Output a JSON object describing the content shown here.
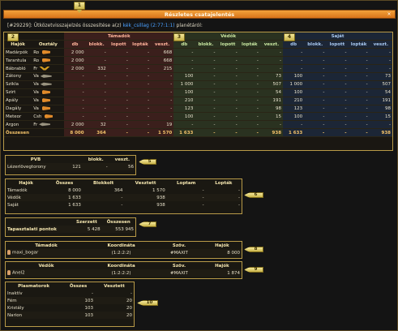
{
  "window": {
    "title": "Részletes csatajelentés",
    "close_symbol": "×"
  },
  "intro": {
    "prefix": "[#29229]: Ütközetvisszajelzés összesítése a(z) ",
    "link": "kék_csillag (2:77:1:1)",
    "suffix": " planétáról:"
  },
  "markers": [
    "1",
    "2",
    "3",
    "4",
    "5",
    "6",
    "7",
    "8",
    "9",
    "10"
  ],
  "battle": {
    "group_headers": {
      "attackers": "Támadók",
      "defenders": "Védők",
      "own": "Saját"
    },
    "col_ships": "Hajók",
    "col_class": "Osztály",
    "sub_cols": [
      "db",
      "blokk.",
      "lopott",
      "lopták",
      "veszt."
    ],
    "rows": [
      {
        "name": "Madárpók",
        "class": "Ro",
        "icon": "orange",
        "a": [
          "2 000",
          "-",
          "-",
          "-",
          "668"
        ],
        "d": [
          "-",
          "-",
          "-",
          "-",
          "-"
        ],
        "s": [
          "-",
          "-",
          "-",
          "-",
          "-"
        ]
      },
      {
        "name": "Tarantula",
        "class": "Ro",
        "icon": "orange",
        "a": [
          "2 000",
          "-",
          "-",
          "-",
          "668"
        ],
        "d": [
          "-",
          "-",
          "-",
          "-",
          "-"
        ],
        "s": [
          "-",
          "-",
          "-",
          "-",
          "-"
        ]
      },
      {
        "name": "Bábrabló",
        "class": "Fr",
        "icon": "ywing",
        "a": [
          "2 000",
          "332",
          "-",
          "-",
          "215"
        ],
        "d": [
          "-",
          "-",
          "-",
          "-",
          "-"
        ],
        "s": [
          "-",
          "-",
          "-",
          "-",
          "-"
        ]
      },
      {
        "name": "Zátony",
        "class": "Va",
        "icon": "grey",
        "a": [
          "-",
          "-",
          "-",
          "-",
          "-"
        ],
        "d": [
          "100",
          "-",
          "-",
          "-",
          "73"
        ],
        "s": [
          "100",
          "-",
          "-",
          "-",
          "73"
        ]
      },
      {
        "name": "Szikla",
        "class": "Va",
        "icon": "grey",
        "a": [
          "-",
          "-",
          "-",
          "-",
          "-"
        ],
        "d": [
          "1 000",
          "-",
          "-",
          "-",
          "507"
        ],
        "s": [
          "1 000",
          "-",
          "-",
          "-",
          "507"
        ]
      },
      {
        "name": "Szirt",
        "class": "Va",
        "icon": "orange",
        "a": [
          "-",
          "-",
          "-",
          "-",
          "-"
        ],
        "d": [
          "100",
          "-",
          "-",
          "-",
          "54"
        ],
        "s": [
          "100",
          "-",
          "-",
          "-",
          "54"
        ]
      },
      {
        "name": "Apály",
        "class": "Va",
        "icon": "orange",
        "a": [
          "-",
          "-",
          "-",
          "-",
          "-"
        ],
        "d": [
          "210",
          "-",
          "-",
          "-",
          "191"
        ],
        "s": [
          "210",
          "-",
          "-",
          "-",
          "191"
        ]
      },
      {
        "name": "Dagály",
        "class": "Va",
        "icon": "orange",
        "a": [
          "-",
          "-",
          "-",
          "-",
          "-"
        ],
        "d": [
          "123",
          "-",
          "-",
          "-",
          "98"
        ],
        "s": [
          "123",
          "-",
          "-",
          "-",
          "98"
        ]
      },
      {
        "name": "Meteor",
        "class": "Csh",
        "icon": "orange",
        "a": [
          "-",
          "-",
          "-",
          "-",
          "-"
        ],
        "d": [
          "100",
          "-",
          "-",
          "-",
          "15"
        ],
        "s": [
          "100",
          "-",
          "-",
          "-",
          "15"
        ]
      },
      {
        "name": "Argon",
        "class": "Fr",
        "icon": "grey",
        "a": [
          "2 000",
          "32",
          "-",
          "-",
          "19"
        ],
        "d": [
          "-",
          "-",
          "-",
          "-",
          "-"
        ],
        "s": [
          "-",
          "-",
          "-",
          "-",
          "-"
        ]
      }
    ],
    "sum": {
      "name": "Összesen",
      "a": [
        "8 000",
        "364",
        "-",
        "-",
        "1 570"
      ],
      "d": [
        "1 633",
        "-",
        "-",
        "-",
        "938"
      ],
      "s": [
        "1 633",
        "-",
        "-",
        "-",
        "938"
      ]
    }
  },
  "pvb": {
    "headers": [
      "PVB",
      "blokk.",
      "veszt."
    ],
    "row": [
      "Lézerlövegtorony",
      "121",
      "-",
      "56"
    ]
  },
  "summary": {
    "headers": [
      "Hajók",
      "Összes",
      "Blokkolt",
      "Vesztett",
      "Loptam",
      "Lopták"
    ],
    "rows": [
      [
        "Támadók",
        "8 000",
        "364",
        "1 570",
        "-",
        "-"
      ],
      [
        "Védők",
        "1 633",
        "-",
        "938",
        "-",
        "-"
      ],
      [
        "Saját",
        "1 633",
        "-",
        "938",
        "-",
        "-"
      ]
    ]
  },
  "points": {
    "headers": [
      "Szerzett",
      "Összesen"
    ],
    "label": "Tapasztalati pontok",
    "values": [
      "5 428",
      "553 945"
    ]
  },
  "attackers": {
    "headers": [
      "Támadók",
      "Koordináta",
      "Szöv.",
      "Hajók"
    ],
    "row": [
      "maxi_bogar",
      "(1:2:2:2)",
      "#MAXIT",
      "8 000"
    ]
  },
  "defenders": {
    "headers": [
      "Védők",
      "Koordináta",
      "Szöv.",
      "Hajók"
    ],
    "row": [
      "Anel2",
      "(1:2:2:2)",
      "#MAXIT",
      "1 874"
    ]
  },
  "plasma": {
    "headers": [
      "Plasmatorok",
      "Összes",
      "Vesztett"
    ],
    "rows": [
      [
        "Inaktív",
        "-",
        "-"
      ],
      [
        "Fém",
        "103",
        "20"
      ],
      [
        "Kristály",
        "103",
        "20"
      ],
      [
        "Narion",
        "103",
        "20"
      ]
    ]
  }
}
